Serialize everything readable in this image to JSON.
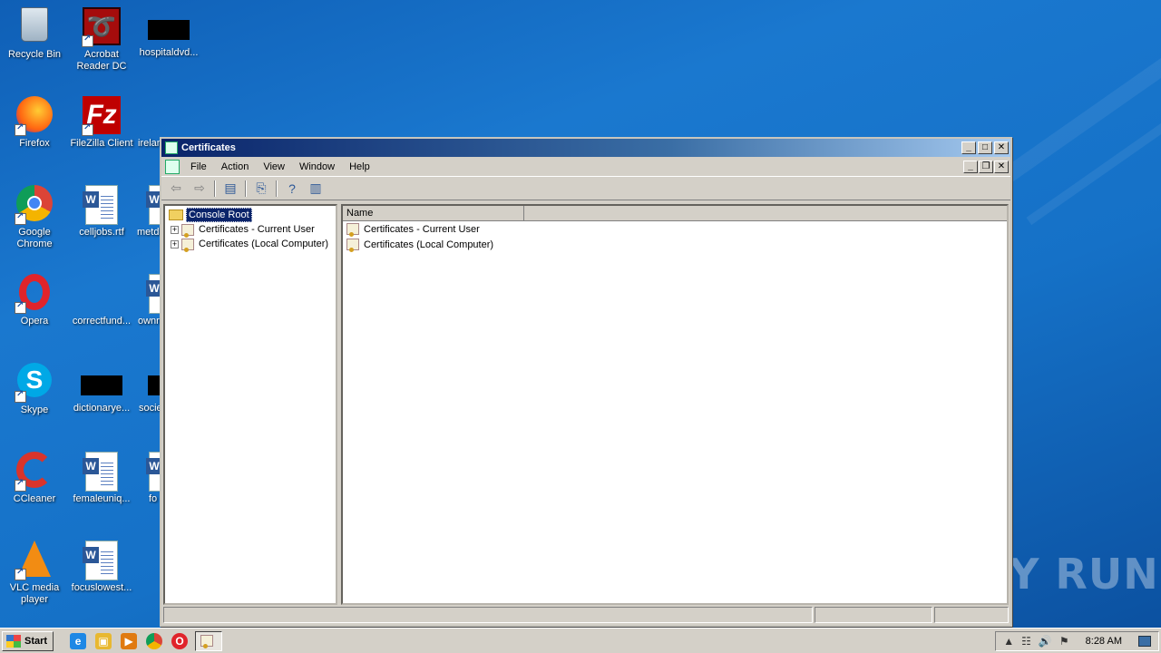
{
  "desktop": {
    "icons": [
      {
        "label": "Recycle Bin"
      },
      {
        "label": "Acrobat Reader DC"
      },
      {
        "label": "hospitaldvd..."
      },
      {
        "label": "Firefox"
      },
      {
        "label": "FileZilla Client"
      },
      {
        "label": "irelan"
      },
      {
        "label": "Google Chrome"
      },
      {
        "label": "celljobs.rtf"
      },
      {
        "label": "metd"
      },
      {
        "label": "Opera"
      },
      {
        "label": "correctfund..."
      },
      {
        "label": "ownr"
      },
      {
        "label": "Skype"
      },
      {
        "label": "dictionarye..."
      },
      {
        "label": "socie"
      },
      {
        "label": "CCleaner"
      },
      {
        "label": "femaleuniq..."
      },
      {
        "label": "fo"
      },
      {
        "label": "VLC media player"
      },
      {
        "label": "focuslowest..."
      }
    ]
  },
  "window": {
    "title": "Certificates",
    "menu": [
      "File",
      "Action",
      "View",
      "Window",
      "Help"
    ],
    "tree": {
      "root": "Console Root",
      "children": [
        "Certificates - Current User",
        "Certificates (Local Computer)"
      ]
    },
    "list": {
      "column": "Name",
      "rows": [
        "Certificates - Current User",
        "Certificates (Local Computer)"
      ]
    }
  },
  "taskbar": {
    "start_label": "Start",
    "clock": "8:28 AM"
  },
  "watermark": "ANY RUN"
}
